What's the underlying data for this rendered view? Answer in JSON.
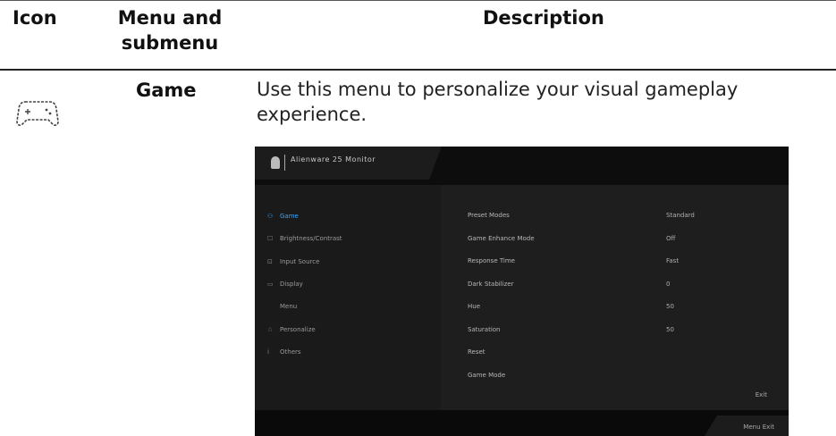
{
  "header": {
    "col_icon": "Icon",
    "col_menu": "Menu and submenu",
    "col_desc": "Description"
  },
  "row": {
    "icon": "gamepad-icon",
    "menu_name": "Game",
    "description": "Use this menu to personalize your visual gameplay experience."
  },
  "osd": {
    "tab_icon": "monitor-icon",
    "tab_title": "Alienware 25 Monitor",
    "active_color": "#3aa7ff",
    "left_menu": [
      {
        "glyph": "⚇",
        "label": "Game",
        "active": true
      },
      {
        "glyph": "☐",
        "label": "Brightness/Contrast",
        "active": false
      },
      {
        "glyph": "⊡",
        "label": "Input Source",
        "active": false
      },
      {
        "glyph": "▭",
        "label": "Display",
        "active": false
      },
      {
        "glyph": "",
        "label": "Menu",
        "active": false
      },
      {
        "glyph": "☆",
        "label": "Personalize",
        "active": false
      },
      {
        "glyph": "i",
        "label": "Others",
        "active": false
      }
    ],
    "settings": [
      {
        "label": "Preset Modes",
        "value": "Standard"
      },
      {
        "label": "Game Enhance Mode",
        "value": "Off"
      },
      {
        "label": "Response Time",
        "value": "Fast"
      },
      {
        "label": "Dark Stabilizer",
        "value": "0"
      },
      {
        "label": "Hue",
        "value": "50"
      },
      {
        "label": "Saturation",
        "value": "50"
      },
      {
        "label": "Reset",
        "value": ""
      },
      {
        "label": "Game Mode",
        "value": ""
      }
    ],
    "corner_label": "Exit",
    "footer_label": "Menu Exit"
  }
}
